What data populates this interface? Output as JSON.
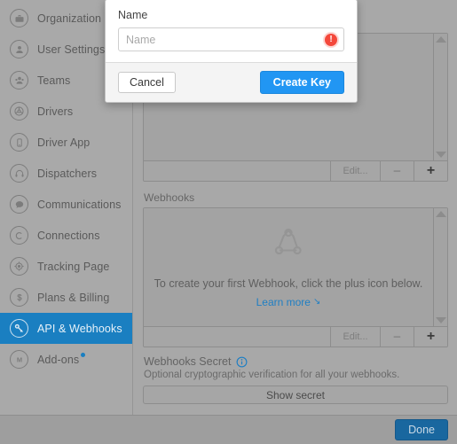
{
  "sidebar": {
    "items": [
      {
        "label": "Organization",
        "icon": "briefcase-icon",
        "active": false,
        "badge": false
      },
      {
        "label": "User Settings",
        "icon": "person-icon",
        "active": false,
        "badge": false
      },
      {
        "label": "Teams",
        "icon": "people-icon",
        "active": false,
        "badge": false
      },
      {
        "label": "Drivers",
        "icon": "steering-wheel-icon",
        "active": false,
        "badge": false
      },
      {
        "label": "Driver App",
        "icon": "phone-icon",
        "active": false,
        "badge": false
      },
      {
        "label": "Dispatchers",
        "icon": "headset-icon",
        "active": false,
        "badge": false
      },
      {
        "label": "Communications",
        "icon": "chat-bubble-icon",
        "active": false,
        "badge": false
      },
      {
        "label": "Connections",
        "icon": "copyright-c-icon",
        "active": false,
        "badge": false
      },
      {
        "label": "Tracking Page",
        "icon": "target-icon",
        "active": false,
        "badge": false
      },
      {
        "label": "Plans & Billing",
        "icon": "dollar-icon",
        "active": false,
        "badge": false
      },
      {
        "label": "API & Webhooks",
        "icon": "key-icon",
        "active": true,
        "badge": false
      },
      {
        "label": "Add-ons",
        "icon": "m-circle-icon",
        "active": false,
        "badge": true
      }
    ]
  },
  "main": {
    "api_keys": {
      "toolbar": {
        "edit_label": "Edit...",
        "minus_label": "−",
        "plus_label": "+"
      }
    },
    "webhooks": {
      "section_label": "Webhooks",
      "empty_text": "To create your first Webhook, click the plus icon below.",
      "learn_more_label": "Learn more",
      "learn_more_arrow": "↘",
      "toolbar": {
        "edit_label": "Edit...",
        "minus_label": "−",
        "plus_label": "+"
      }
    },
    "webhooks_secret": {
      "title": "Webhooks Secret",
      "description": "Optional cryptographic verification for all your webhooks.",
      "button_label": "Show secret"
    }
  },
  "footer": {
    "done_label": "Done"
  },
  "modal": {
    "label": "Name",
    "input_value": "",
    "input_placeholder": "Name",
    "error_glyph": "!",
    "cancel_label": "Cancel",
    "create_label": "Create Key"
  },
  "colors": {
    "accent_blue": "#2196f3",
    "sidebar_active": "#1a7fc1",
    "error_red": "#f4483b",
    "link_blue": "#1f7fc4",
    "done_blue": "#19679f"
  }
}
